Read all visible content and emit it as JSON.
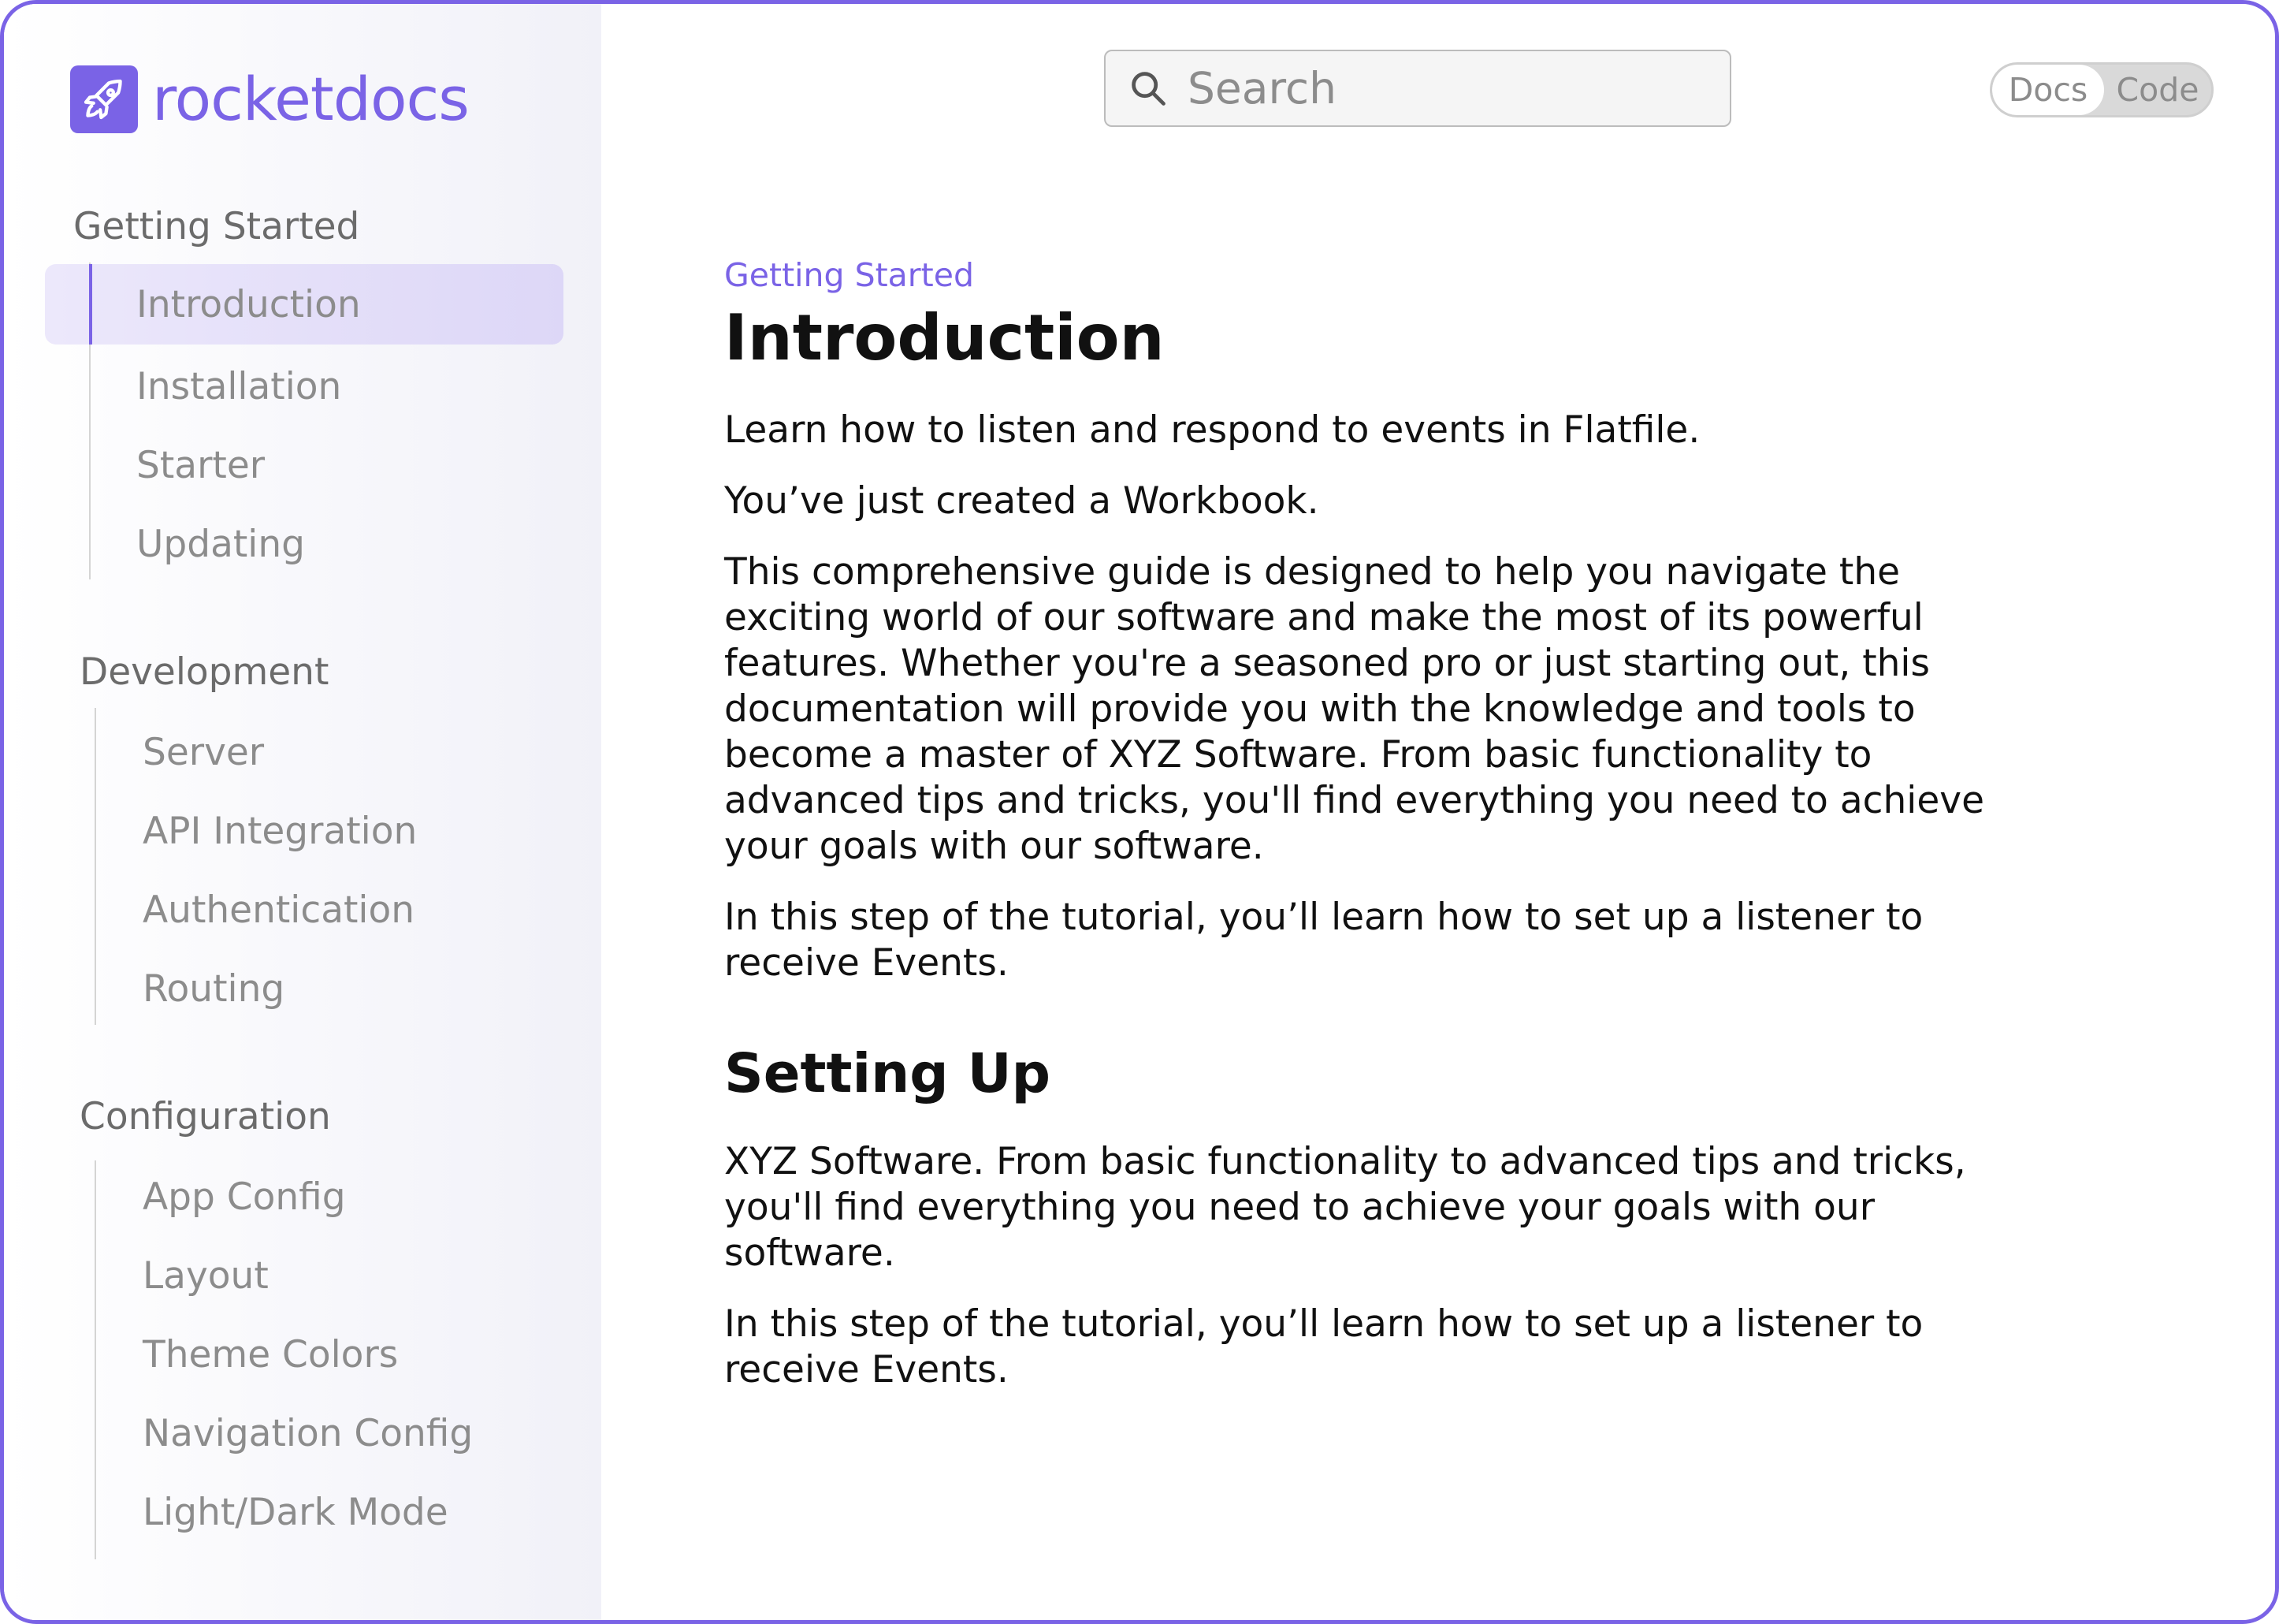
{
  "brand": {
    "name": "rocketdocs",
    "accent": "#7a63e6",
    "icon": "rocket-icon"
  },
  "search": {
    "placeholder": "Search",
    "icon": "search-icon"
  },
  "mode_toggle": {
    "options": [
      "Docs",
      "Code"
    ],
    "selected": "Docs"
  },
  "sidebar": {
    "sections": [
      {
        "title": "Getting Started",
        "items": [
          "Introduction",
          "Installation",
          "Starter",
          "Updating"
        ]
      },
      {
        "title": "Development",
        "items": [
          "Server",
          "API Integration",
          "Authentication",
          "Routing"
        ]
      },
      {
        "title": "Configuration",
        "items": [
          "App Config",
          "Layout",
          "Theme Colors",
          "Navigation Config",
          "Light/Dark Mode"
        ]
      }
    ],
    "active_item": "Introduction"
  },
  "article": {
    "eyebrow": "Getting Started",
    "title": "Introduction",
    "paragraphs": [
      "Learn how to listen and respond to events in Flatfile.",
      "You’ve just created a Workbook.",
      "This comprehensive guide is designed to help you navigate the exciting world of our software and make the most of its powerful features. Whether you're a seasoned pro or just starting out, this documentation will provide you with the knowledge and tools to become a master of XYZ Software. From basic functionality to advanced tips and tricks, you'll find everything you need to achieve your goals with our software.",
      "In this step of the tutorial, you’ll learn how to set up a listener to receive Events."
    ],
    "section_heading": "Setting Up",
    "section_paragraphs": [
      "XYZ Software. From basic functionality to advanced tips and tricks, you'll find everything you need to achieve your goals with our software.",
      "In this step of the tutorial, you’ll learn how to set up a listener to receive Events."
    ]
  }
}
